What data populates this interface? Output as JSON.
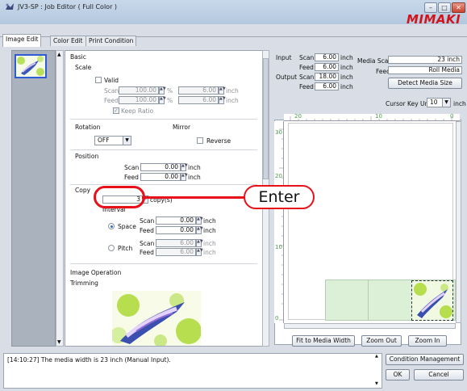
{
  "window": {
    "title": "JV3-SP : Job Editor ( Full Color )",
    "logo": "MIMAKI",
    "controls": {
      "minimize": "–",
      "maximize": "□",
      "close": "✕"
    }
  },
  "tabs": [
    {
      "label": "Image Edit",
      "active": true
    },
    {
      "label": "Color Edit",
      "active": false
    },
    {
      "label": "Print Condition",
      "active": false
    }
  ],
  "left_panel": {
    "basic": "Basic",
    "scale": {
      "heading": "Scale",
      "valid_label": "Valid",
      "scan_label": "Scan",
      "scan_pct": "100.00",
      "scan_inch": "6.00",
      "feed_label": "Feed",
      "feed_pct": "100.00",
      "feed_inch": "6.00",
      "pct_unit": "%",
      "inch_unit": "inch",
      "keep_ratio": "Keep Ratio"
    },
    "rotation": {
      "heading": "Rotation",
      "value": "OFF"
    },
    "mirror": {
      "heading": "Mirror",
      "reverse_label": "Reverse"
    },
    "position": {
      "heading": "Position",
      "scan_label": "Scan",
      "scan_value": "0.00",
      "feed_label": "Feed",
      "feed_value": "0.00",
      "unit": "inch"
    },
    "copy": {
      "heading": "Copy",
      "count": "3",
      "unit": "copy(s)",
      "interval_label": "Interval",
      "space_label": "Space",
      "pitch_label": "Pitch",
      "space_scan": "0.00",
      "space_feed": "0.00",
      "pitch_scan": "6.00",
      "pitch_feed": "6.00",
      "scan_label": "Scan",
      "feed_label": "Feed",
      "unit_inch": "inch"
    },
    "image_operation": "Image Operation",
    "trimming": "Trimming"
  },
  "right_panel": {
    "input_label": "Input",
    "output_label": "Output",
    "scan_label": "Scan",
    "feed_label": "Feed",
    "input_scan": "6.00",
    "input_feed": "6.00",
    "output_scan": "18.00",
    "output_feed": "6.00",
    "unit": "inch",
    "media_scan_label": "Media Scan",
    "media_scan_value": "23 inch",
    "media_feed_label": "Feed",
    "media_feed_value": "Roll Media",
    "detect_button": "Detect Media Size",
    "cursor_key_unit_label": "Cursor Key Unit",
    "cursor_key_unit_value": "10",
    "cursor_key_unit_suffix": "inch",
    "ruler_top": [
      "20",
      "10",
      "0"
    ],
    "ruler_left": [
      "0",
      "10",
      "20",
      "30"
    ],
    "fit_button": "Fit to Media Width",
    "zoom_out_button": "Zoom Out",
    "zoom_in_button": "Zoom In"
  },
  "log": {
    "message": "[14:10:27] The media width is 23 inch (Manual Input)."
  },
  "buttons": {
    "condition_management": "Condition Management",
    "ok": "OK",
    "cancel": "Cancel"
  },
  "callout": {
    "text": "Enter"
  },
  "colors": {
    "accent": "#e8101a",
    "selection": "#2f5bd4",
    "media": "#dcefd7"
  }
}
